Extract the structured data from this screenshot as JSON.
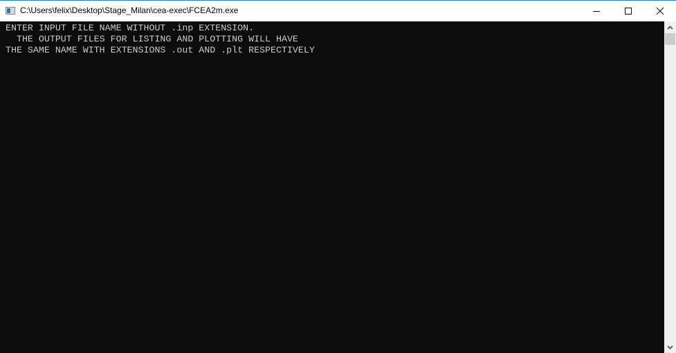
{
  "window": {
    "title": "C:\\Users\\felix\\Desktop\\Stage_Milan\\cea-exec\\FCEA2m.exe",
    "icon": "console-app-icon",
    "controls": [
      "minimize",
      "maximize",
      "close"
    ]
  },
  "console": {
    "lines": [
      "ENTER INPUT FILE NAME WITHOUT .inp EXTENSION.",
      "  THE OUTPUT FILES FOR LISTING AND PLOTTING WILL HAVE",
      "THE SAME NAME WITH EXTENSIONS .out AND .plt RESPECTIVELY"
    ]
  },
  "colors": {
    "background": "#0c0c0c",
    "text": "#cccccc",
    "titlebar": "#ffffff",
    "accent_border": "#1883d7"
  }
}
